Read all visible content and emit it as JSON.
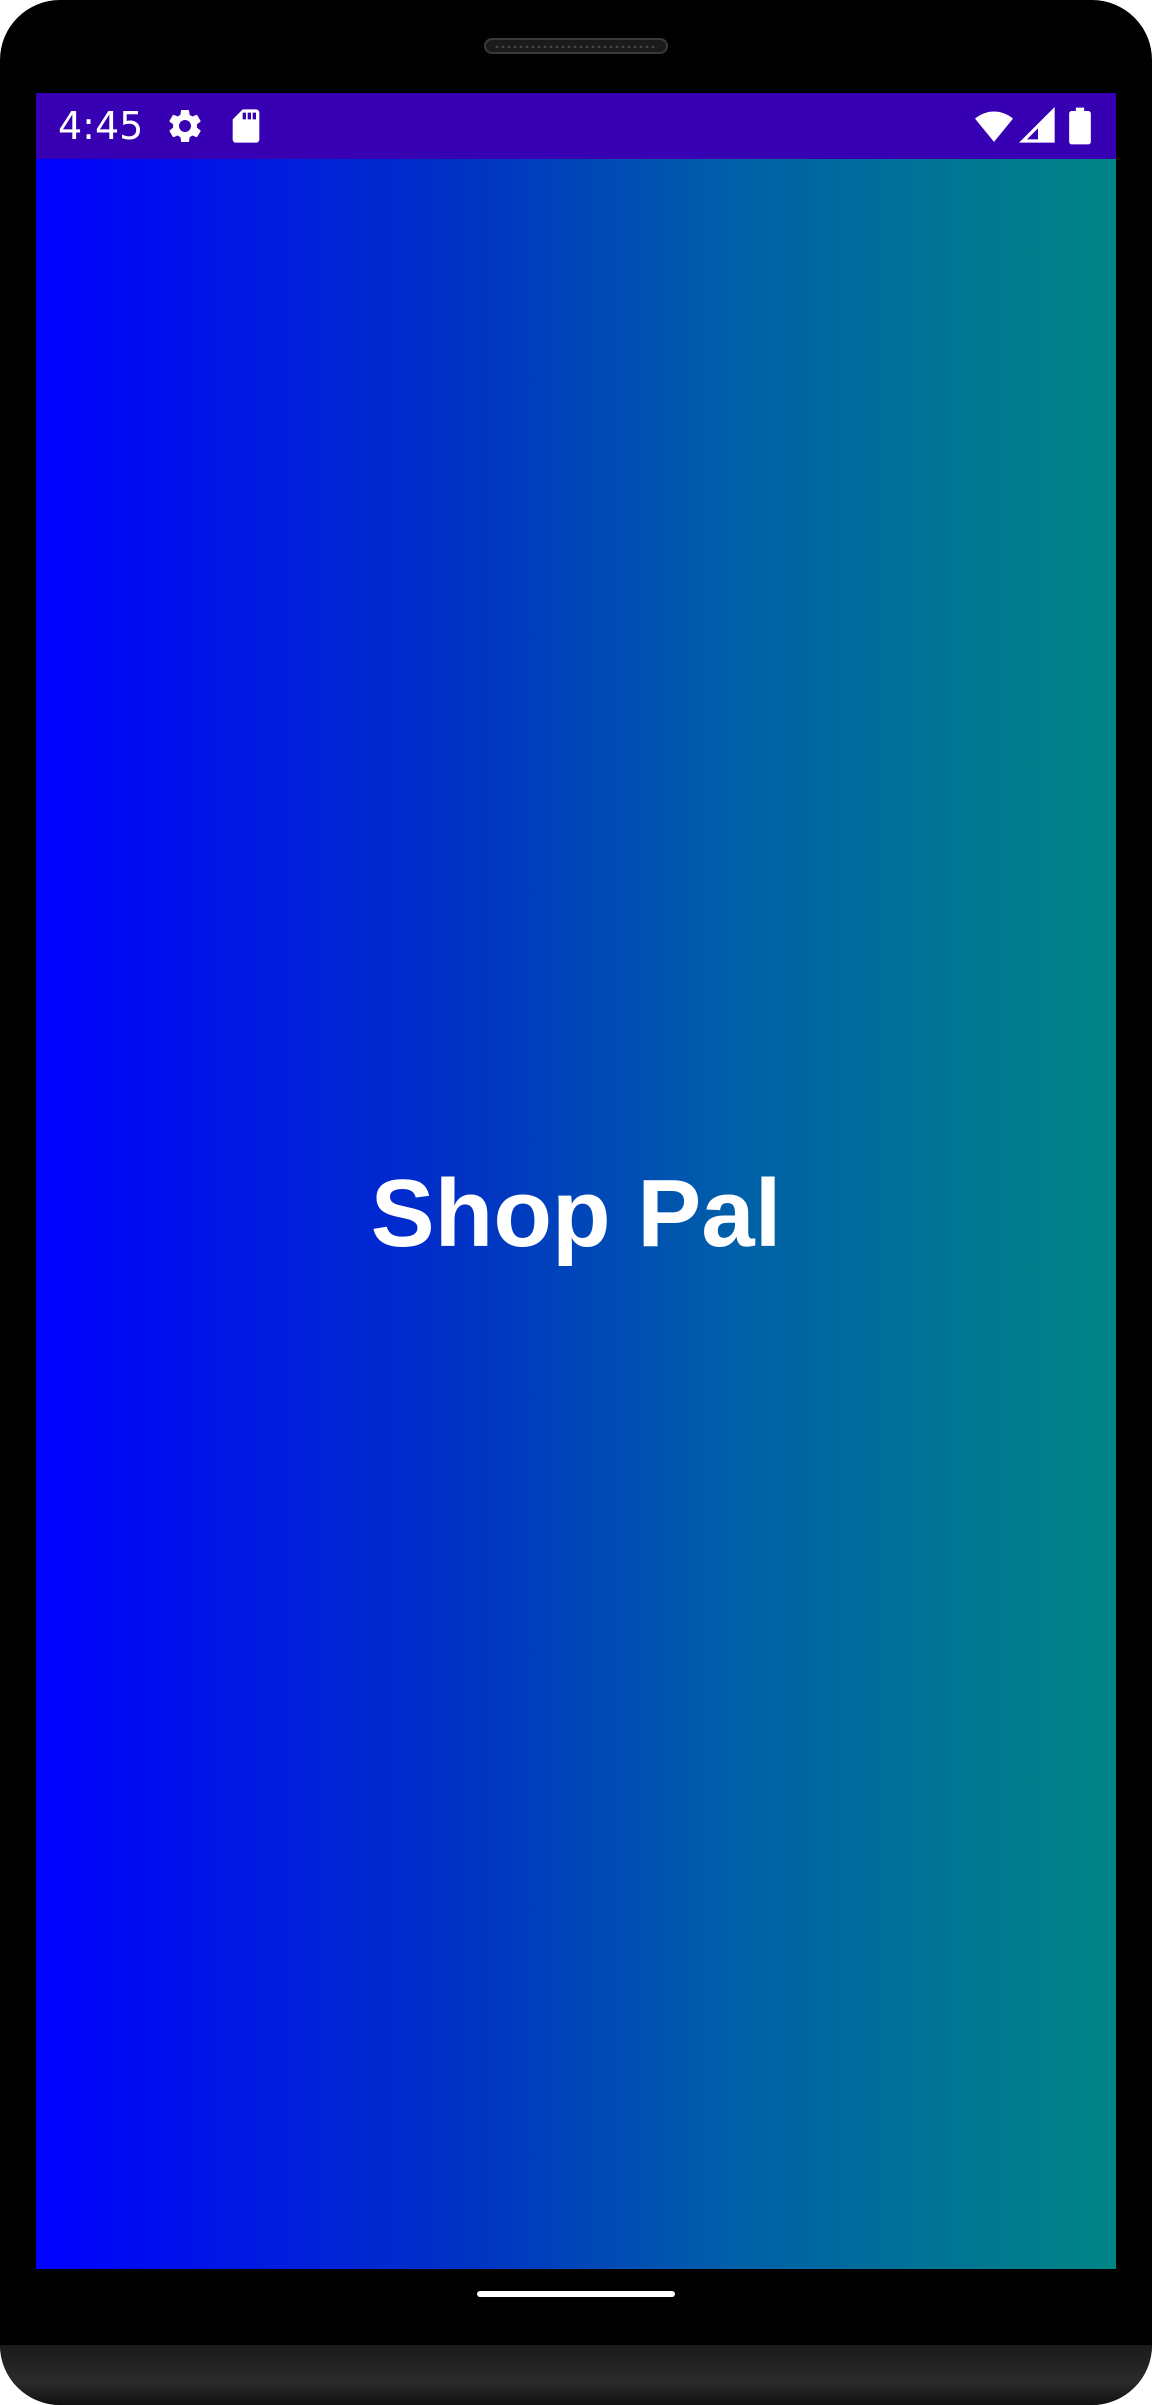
{
  "status_bar": {
    "time": "4:45",
    "background_color": "#3700b3",
    "icons": [
      "settings-icon",
      "sd-card-icon",
      "wifi-icon",
      "signal-icon",
      "battery-icon"
    ]
  },
  "splash": {
    "title": "Shop Pal",
    "gradient_colors": [
      "#0000ff",
      "#008585"
    ]
  }
}
